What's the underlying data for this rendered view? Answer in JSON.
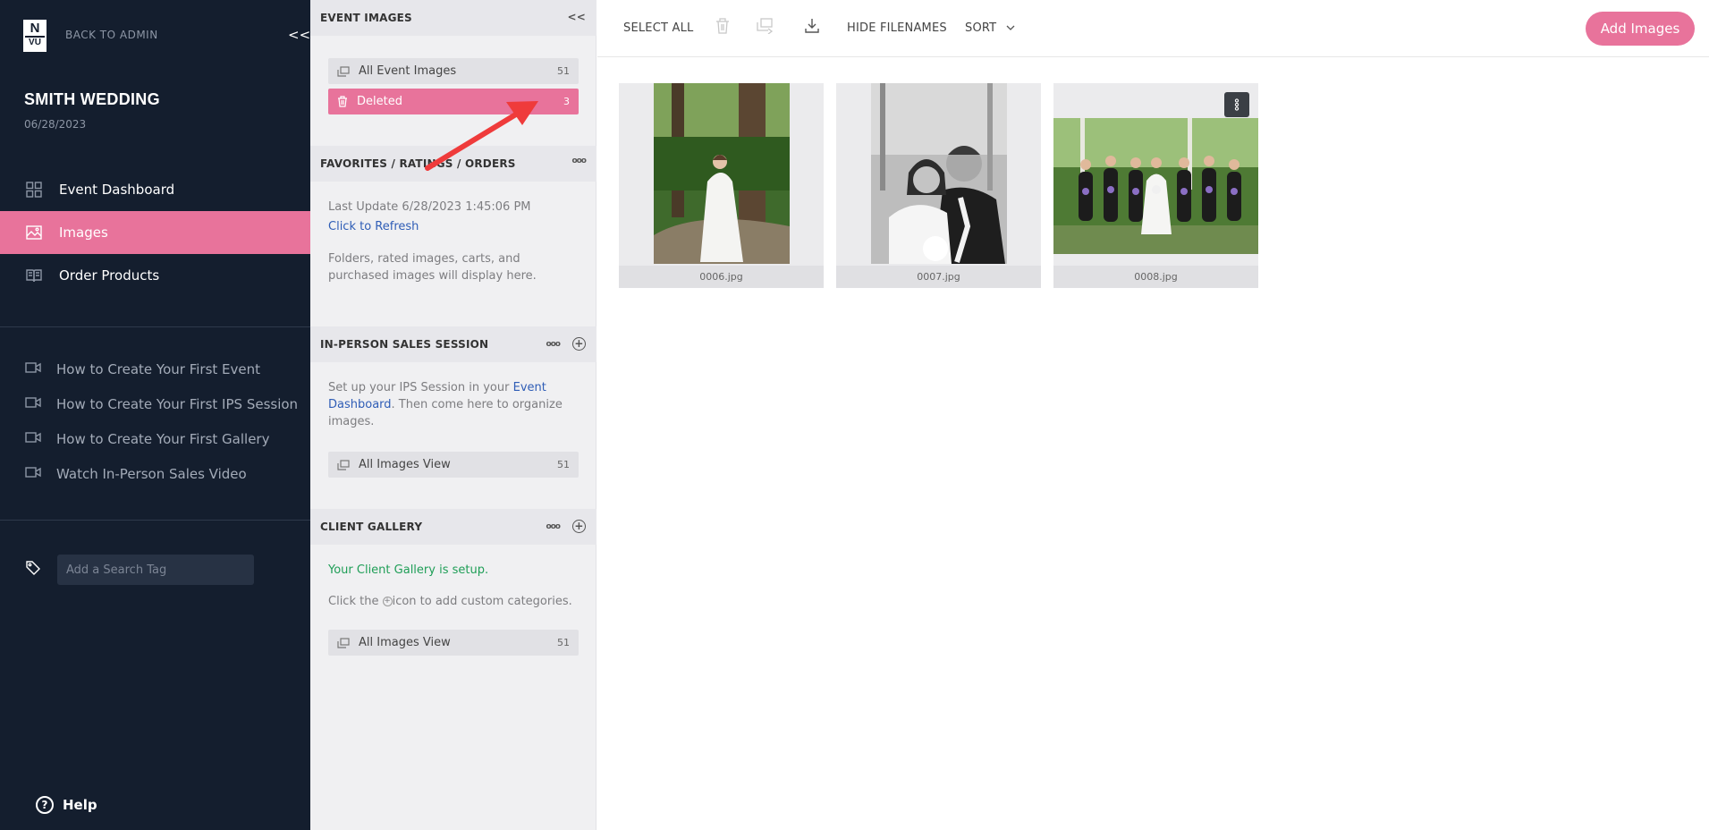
{
  "sidebar": {
    "logo_top": "N",
    "logo_bottom": "VU",
    "back_label": "BACK TO ADMIN",
    "collapse": "<<",
    "event_title": "SMITH WEDDING",
    "event_date": "06/28/2023",
    "nav": [
      {
        "label": "Event Dashboard",
        "icon": "grid-icon"
      },
      {
        "label": "Images",
        "icon": "image-icon",
        "active": true
      },
      {
        "label": "Order Products",
        "icon": "book-icon"
      }
    ],
    "help_links": [
      {
        "label": "How to Create Your First Event"
      },
      {
        "label": "How to Create Your First IPS Session"
      },
      {
        "label": "How to Create Your First Gallery"
      },
      {
        "label": "Watch In-Person Sales Video"
      }
    ],
    "tag_placeholder": "Add a Search Tag",
    "help_label": "Help",
    "help_symbol": "?"
  },
  "panel": {
    "event_images": {
      "title": "EVENT IMAGES",
      "collapse": "<<",
      "folders": [
        {
          "label": "All Event Images",
          "count": "51"
        },
        {
          "label": "Deleted",
          "count": "3",
          "active": true
        }
      ]
    },
    "favorites": {
      "title": "FAVORITES / RATINGS / ORDERS",
      "last_update": "Last Update 6/28/2023 1:45:06 PM",
      "refresh": "Click to Refresh",
      "note": "Folders, rated images, carts, and purchased images will display here."
    },
    "ips": {
      "title": "IN-PERSON SALES SESSION",
      "text_before": "Set up your IPS Session in your ",
      "link": "Event Dashboard",
      "text_after": ". Then come here to organize images.",
      "folder": {
        "label": "All Images View",
        "count": "51"
      }
    },
    "client_gallery": {
      "title": "CLIENT GALLERY",
      "status": "Your Client Gallery is setup.",
      "hint_before": "Click the ",
      "hint_after": "icon to add custom categories.",
      "folder": {
        "label": "All Images View",
        "count": "51"
      }
    }
  },
  "toolbar": {
    "select_all": "SELECT ALL",
    "hide_filenames": "HIDE FILENAMES",
    "sort": "SORT",
    "add_images": "Add Images"
  },
  "images": [
    {
      "filename": "0006.jpg"
    },
    {
      "filename": "0007.jpg"
    },
    {
      "filename": "0008.jpg"
    }
  ],
  "colors": {
    "accent": "#e8739b",
    "sidebar_bg": "#141e2e",
    "link": "#2f5db6",
    "success": "#1f9e57",
    "annotation_arrow": "#ef3b3b"
  }
}
